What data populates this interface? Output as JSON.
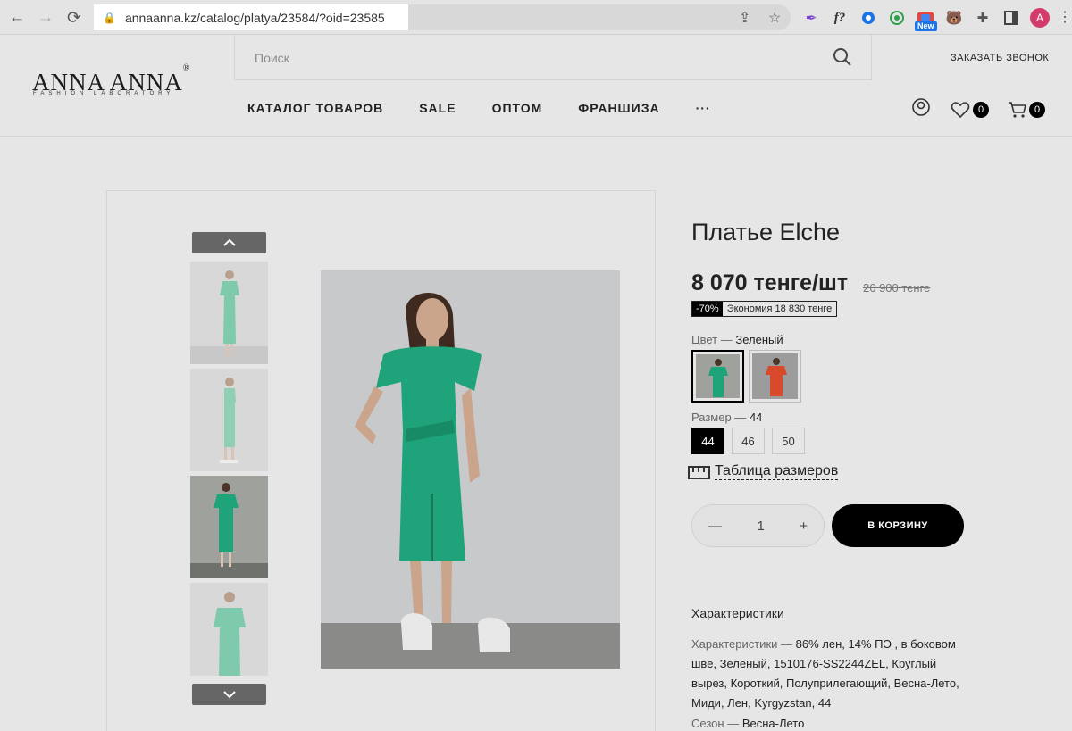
{
  "browser": {
    "url": "annaanna.kz/catalog/platya/23584/?oid=23585",
    "new_badge": "New",
    "avatar_letter": "A"
  },
  "header": {
    "logo": "ANNA ANNA",
    "logo_mark": "®",
    "logo_tagline": "FASHION LABORATORY",
    "search_placeholder": "Поиск",
    "callback": "ЗАКАЗАТЬ ЗВОНОК",
    "nav": [
      "КАТАЛОГ ТОВАРОВ",
      "SALE",
      "ОПТОМ",
      "ФРАНШИЗА",
      "···"
    ],
    "wishlist_count": "0",
    "cart_count": "0"
  },
  "product": {
    "title": "Платье Elche",
    "price": "8 070 тенге/шт",
    "old_price": "26 900 тенге",
    "discount_pct": "-70%",
    "savings": "Экономия 18 830 тенге",
    "color_label": "Цвет",
    "color_value": "Зеленый",
    "size_label": "Размер",
    "size_value": "44",
    "sizes": [
      "44",
      "46",
      "50"
    ],
    "size_table": "Таблица размеров",
    "quantity": "1",
    "qty_minus": "—",
    "qty_plus": "+",
    "add_to_cart": "В КОРЗИНУ",
    "specs_title": "Характеристики",
    "specs_key": "Характеристики",
    "specs_value": "86% лен, 14% ПЭ , в боковом шве, Зеленый, 1510176-SS2244ZEL, Круглый вырез, Короткий, Полуприлегающий, Весна-Лето, Миди, Лен, Kyrgyzstan, 44",
    "season_key": "Сезон",
    "season_value": "Весна-Лето",
    "separator": "—"
  },
  "colors": {
    "dress_green": "#1fa37a",
    "dress_red": "#d94a2c",
    "accent": "#000000"
  }
}
